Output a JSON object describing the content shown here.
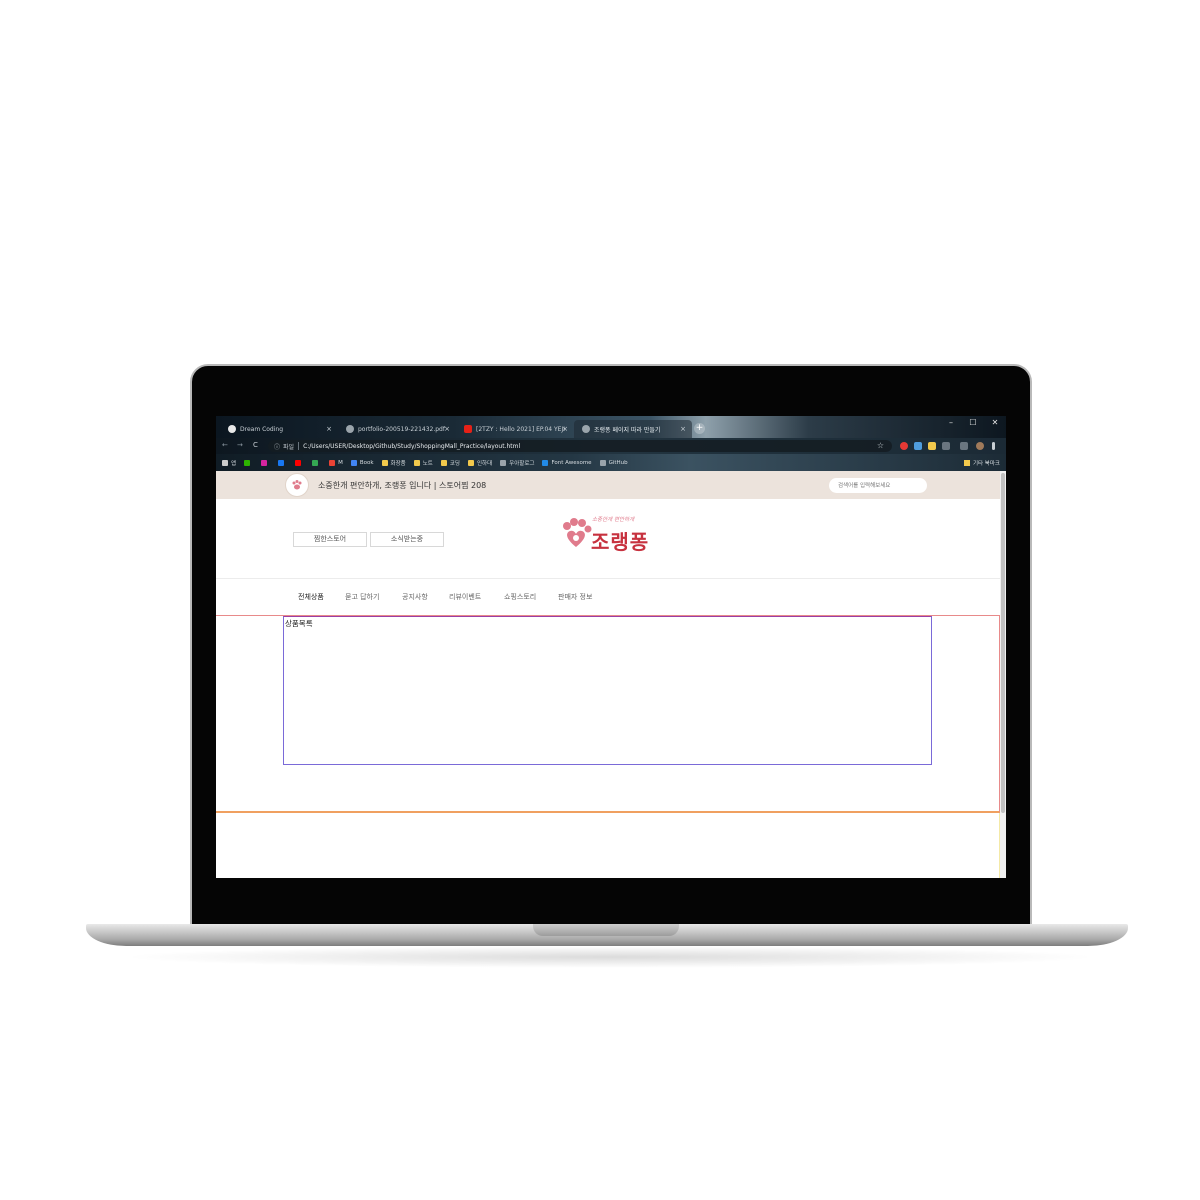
{
  "browser": {
    "tabs": [
      {
        "label": "Dream Coding",
        "favicon_color": "#e8e8e8"
      },
      {
        "label": "portfolio-200519-221432.pdf",
        "favicon_color": "#9aa4ab"
      },
      {
        "label": "[2TZY : Hello 2021] EP.04 YEJI",
        "favicon_color": "#e62117"
      },
      {
        "label": "조랭퐁 페이지 따라 만들기",
        "favicon_color": "#9aa4ab"
      }
    ],
    "close_glyph": "×",
    "new_tab_glyph": "+",
    "window_controls": [
      "–",
      "☐",
      "✕"
    ],
    "nav": {
      "back": "←",
      "forward": "→",
      "reload": "C"
    },
    "address": {
      "info_icon": "ⓘ",
      "scheme_label": "파일",
      "url": "C:/Users/USER/Desktop/Github/Study/ShoppingMall_Practice/layout.html",
      "star": "☆"
    },
    "bookmarks": [
      {
        "label": "앱",
        "icon_color": "#cccccc"
      },
      {
        "label": "",
        "icon_color": "#2db400"
      },
      {
        "label": "",
        "icon_color": "#d6249f"
      },
      {
        "label": "",
        "icon_color": "#1877f2"
      },
      {
        "label": "",
        "icon_color": "#ff0000"
      },
      {
        "label": "",
        "icon_color": "#34a853"
      },
      {
        "label": "M",
        "icon_color": "#ea4335"
      },
      {
        "label": "Book",
        "icon_color": "#4285f4"
      },
      {
        "label": "화장품",
        "icon_color": "#f2c94c"
      },
      {
        "label": "노트",
        "icon_color": "#f2c94c"
      },
      {
        "label": "코딩",
        "icon_color": "#f2c94c"
      },
      {
        "label": "인하대",
        "icon_color": "#f2c94c"
      },
      {
        "label": "우아할로그",
        "icon_color": "#9aa4ab"
      },
      {
        "label": "Font Awesome",
        "icon_color": "#228ae6"
      },
      {
        "label": "GitHub",
        "icon_color": "#9aa4ab"
      }
    ],
    "bookmarks_other": "기타 북마크"
  },
  "site": {
    "topbar": {
      "text": "소중한개 편안하개, 조랭퐁 입니다 | 스토어찜 208",
      "search_placeholder": "검색어를 입력해보세요"
    },
    "header": {
      "buttons": [
        "찜한스토어",
        "소식받는중"
      ],
      "brand_tagline": "소중한개 편안하개",
      "brand_name": "조랭퐁"
    },
    "nav": [
      "전체상품",
      "묻고 답하기",
      "공지사항",
      "리뷰이벤트",
      "쇼핑스토리",
      "판매자 정보"
    ],
    "section_label": "상품목록"
  },
  "colors": {
    "topbar_bg": "#ece3dc",
    "brand": "#c7323f",
    "brand_light": "#e07b8c",
    "outer_border": "#e88a8a",
    "outer_bottom": "#f0a060",
    "inner_border": "#7a6ad8"
  }
}
